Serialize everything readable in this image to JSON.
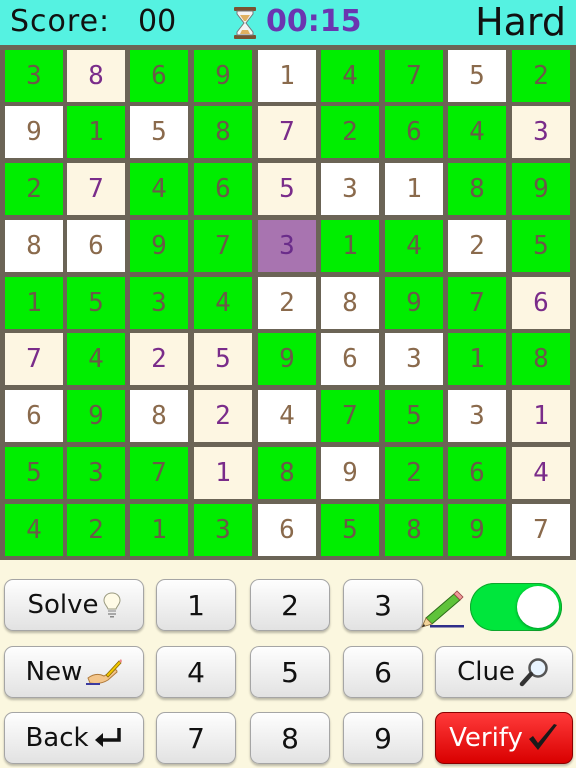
{
  "header": {
    "score_label": "Score:",
    "score_value": "00",
    "timer": "00:15",
    "difficulty": "Hard"
  },
  "board": {
    "rows": [
      [
        "3",
        "8",
        "6",
        "9",
        "1",
        "4",
        "7",
        "5",
        "2"
      ],
      [
        "9",
        "1",
        "5",
        "8",
        "7",
        "2",
        "6",
        "4",
        "3"
      ],
      [
        "2",
        "7",
        "4",
        "6",
        "5",
        "3",
        "1",
        "8",
        "9"
      ],
      [
        "8",
        "6",
        "9",
        "7",
        "3",
        "1",
        "4",
        "2",
        "5"
      ],
      [
        "1",
        "5",
        "3",
        "4",
        "2",
        "8",
        "9",
        "7",
        "6"
      ],
      [
        "7",
        "4",
        "2",
        "5",
        "9",
        "6",
        "3",
        "1",
        "8"
      ],
      [
        "6",
        "9",
        "8",
        "2",
        "4",
        "7",
        "5",
        "3",
        "1"
      ],
      [
        "5",
        "3",
        "7",
        "1",
        "8",
        "9",
        "2",
        "6",
        "4"
      ],
      [
        "4",
        "2",
        "1",
        "3",
        "6",
        "5",
        "8",
        "9",
        "7"
      ]
    ],
    "styles": [
      [
        "g",
        "c",
        "g",
        "g",
        "w",
        "g",
        "g",
        "w",
        "g"
      ],
      [
        "w",
        "g",
        "w",
        "g",
        "c",
        "g",
        "g",
        "g",
        "c"
      ],
      [
        "g",
        "c",
        "g",
        "g",
        "c",
        "w",
        "w",
        "g",
        "g"
      ],
      [
        "w",
        "w",
        "g",
        "g",
        "s",
        "g",
        "g",
        "w",
        "g"
      ],
      [
        "g",
        "g",
        "g",
        "g",
        "w",
        "w",
        "g",
        "g",
        "c"
      ],
      [
        "c",
        "g",
        "c",
        "c",
        "g",
        "w",
        "w",
        "g",
        "g"
      ],
      [
        "w",
        "g",
        "w",
        "c",
        "w",
        "g",
        "g",
        "w",
        "c"
      ],
      [
        "g",
        "g",
        "g",
        "c",
        "g",
        "w",
        "g",
        "g",
        "c"
      ],
      [
        "g",
        "g",
        "g",
        "g",
        "w",
        "g",
        "g",
        "g",
        "w"
      ]
    ],
    "selected_cell": "3"
  },
  "controls": {
    "solve_label": "Solve",
    "new_label": "New",
    "back_label": "Back",
    "clue_label": "Clue",
    "verify_label": "Verify",
    "digits": [
      "1",
      "2",
      "3",
      "4",
      "5",
      "6",
      "7",
      "8",
      "9"
    ],
    "pencil_toggle_on": true
  },
  "colors": {
    "given": "#00ee00",
    "empty": "#ffffff",
    "entered": "#fdf6e2",
    "selected": "#a874b0",
    "header": "#55f2e1",
    "verify": "#e60000"
  },
  "icons": {
    "hourglass": "hourglass-icon",
    "solve": "lightbulb-icon",
    "new": "writing-hand-icon",
    "back": "return-arrow-icon",
    "clue": "magnifier-icon",
    "verify": "checkmark-icon",
    "pencil": "pencil-icon"
  }
}
